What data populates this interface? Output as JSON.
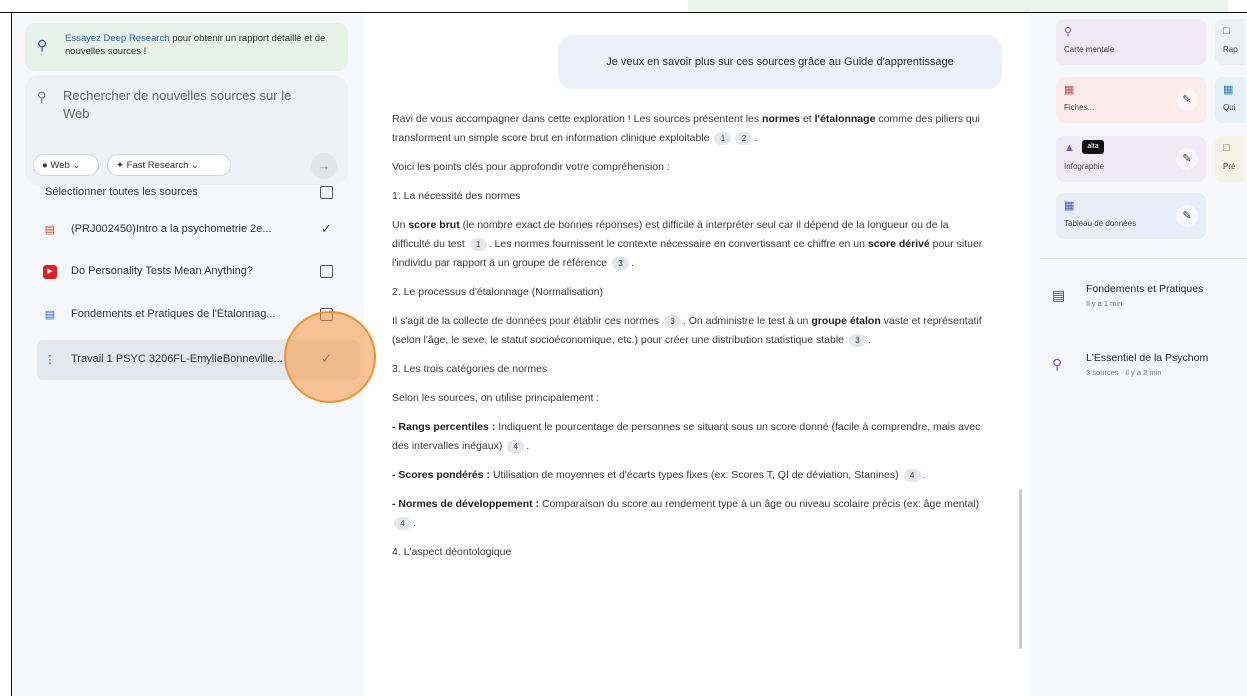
{
  "deep_research": {
    "link": "Essayez Deep Research",
    "text": " pour obtenir un rapport détaillé et de nouvelles sources !"
  },
  "search": {
    "placeholder": "Rechercher de nouvelles sources sur le Web",
    "web_chip": "Web",
    "fast_chip": "Fast Research"
  },
  "sources": {
    "select_all": "Sélectionner toutes les sources",
    "items": [
      {
        "label": "(PRJ002450)Intro a la psychometrie 2e...",
        "type": "pdf",
        "checked": true
      },
      {
        "label": "Do Personality Tests Mean Anything?",
        "type": "youtube",
        "checked": false
      },
      {
        "label": "Fondements et Pratiques de l'Étalonnag...",
        "type": "doc",
        "checked": false
      },
      {
        "label": "Travail 1 PSYC 3206FL-EmylieBonneville...",
        "type": "text",
        "checked": true
      }
    ]
  },
  "chat": {
    "user_message": "Je veux en savoir plus sur ces sources grâce au Guide d'apprentissage",
    "intro_a": "Ravi de vous accompagner dans cette exploration ! Les sources présentent les ",
    "intro_b1": "normes",
    "intro_c": " et ",
    "intro_b2": "l'étalonnage",
    "intro_d": " comme des piliers qui transforment un simple score brut en information clinique exploitable",
    "key_points": "Voici les points clés pour approfondir votre compréhension :",
    "s1_title": "1. La nécessité des normes",
    "s1_a": "Un ",
    "s1_b": "score brut",
    "s1_c": " (le nombre exact de bonnes réponses) est difficile à interpréter seul car il dépend de la longueur ou de la difficulté du test",
    "s1_d": ". Les normes fournissent le contexte nécessaire en convertissant ce chiffre en un ",
    "s1_e": "score dérivé",
    "s1_f": " pour situer l'individu par rapport à un groupe de référence",
    "s2_title": "2. Le processus d'étalonnage (Normalisation)",
    "s2_a": "Il s'agit de la collecte de données pour établir ces normes",
    "s2_b": ". On administre le test à un ",
    "s2_c": "groupe étalon",
    "s2_d": " vaste et représentatif (selon l'âge, le sexe, le statut socioéconomique, etc.) pour créer une distribution statistique stable",
    "s3_title": "3. Les trois catégories de normes",
    "s3_intro": "Selon les sources, on utilise principalement :",
    "b1_a": "- Rangs percentiles :",
    "b1_b": " Indiquent le pourcentage de personnes se situant sous un score donné (facile à comprendre, mais avec des intervalles inégaux)",
    "b2_a": "- Scores pondérés :",
    "b2_b": " Utilisation de moyennes et d'écarts types fixes (ex: Scores T, QI de déviation, Stanines)",
    "b3_a": "- Normes de développement :",
    "b3_b": " Comparaison du score au rendement type à un âge ou niveau scolaire précis (ex: âge mental)",
    "s4_title": "4. L'aspect déontologique",
    "cites": {
      "c1": "1",
      "c2": "2",
      "c3": "3",
      "c4": "4"
    }
  },
  "studio": {
    "tiles": {
      "mind_map": "Carte mentale",
      "flashcards": "Fiches...",
      "infographic": "Infographie",
      "infographic_badge": "alta",
      "data_table": "Tableau de données",
      "report_partial": "Rap",
      "quiz_partial": "Qui",
      "pres_partial": "Pré"
    },
    "notes": [
      {
        "title": "Fondements et Pratiques",
        "sub": "Il y a 1 min"
      },
      {
        "title": "L'Essentiel de la Psychom",
        "sub": "3 sources · Il y a 2 min"
      }
    ]
  },
  "colors": {
    "accent": "#2d63c4",
    "mind_map_bg": "#f1e9f6",
    "flashcards_bg": "#fbecea",
    "infographic_bg": "#f1e9f6",
    "data_table_bg": "#e9edf8",
    "cursor": "#f5963c"
  }
}
